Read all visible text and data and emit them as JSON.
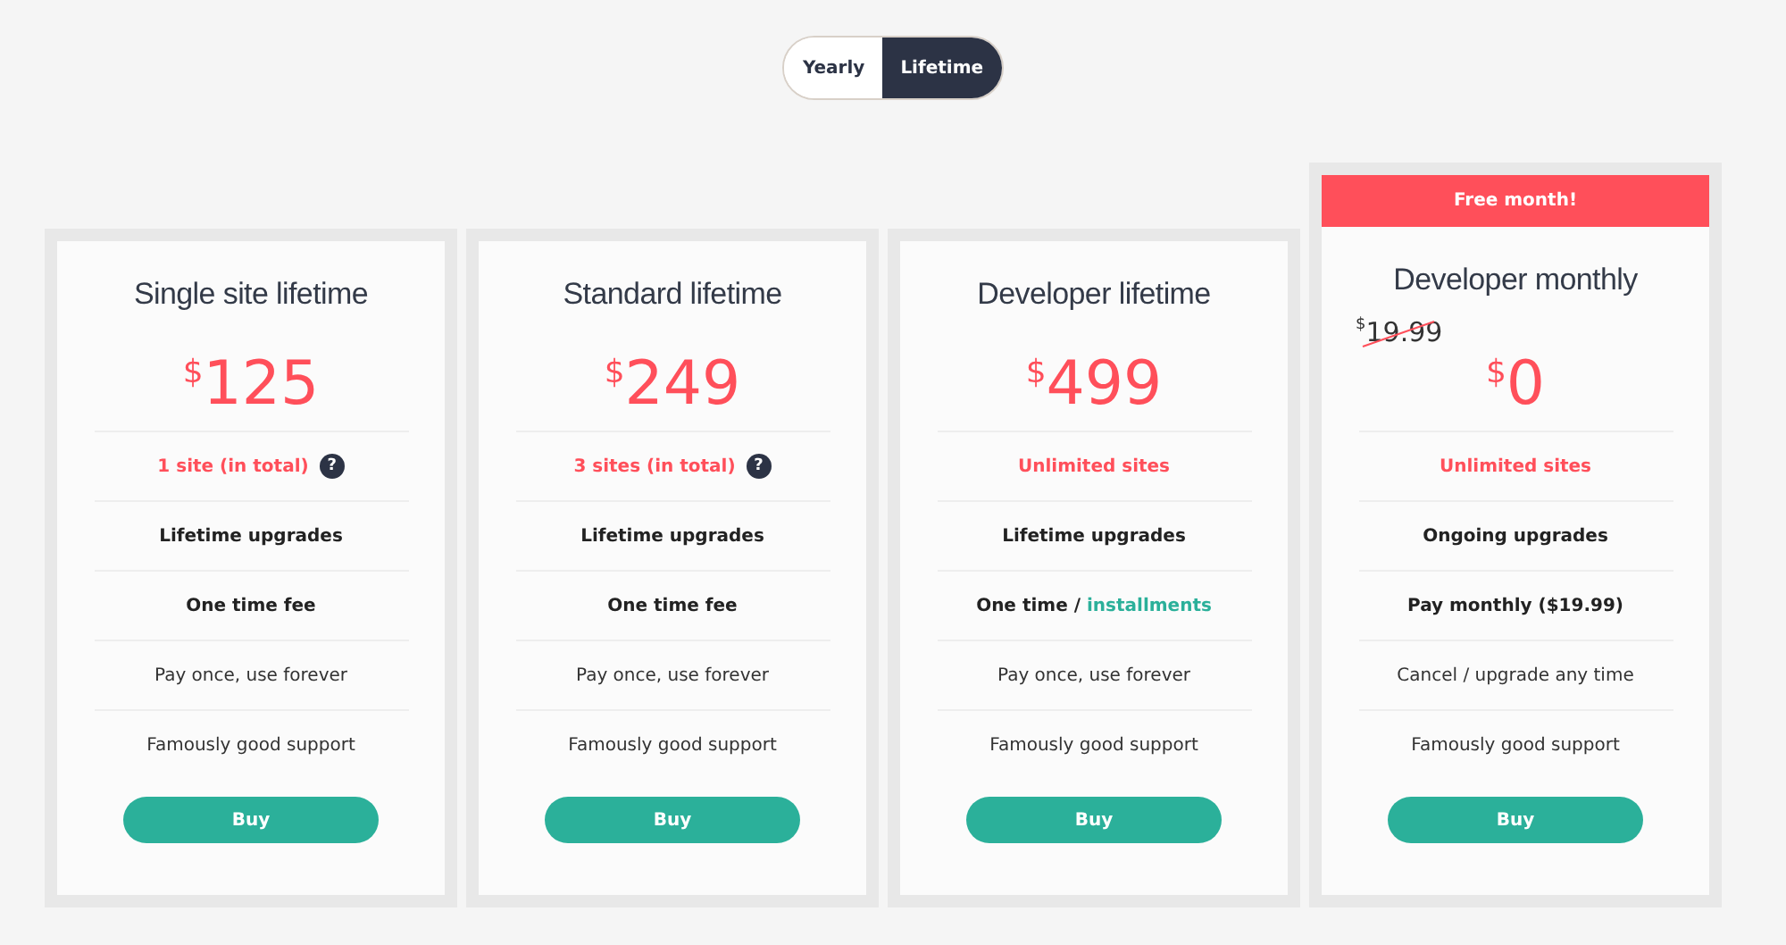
{
  "toggle": [
    {
      "label": "Yearly",
      "selected": false
    },
    {
      "label": "Lifetime",
      "selected": true
    }
  ],
  "plans": [
    {
      "title": "Single site lifetime",
      "currency": "$",
      "amount": "125",
      "features": [
        {
          "kind": "highlight",
          "text": "1 site (in total)",
          "help": "?"
        },
        {
          "kind": "bold",
          "text": "Lifetime upgrades"
        },
        {
          "kind": "bold",
          "text": "One time fee"
        },
        {
          "kind": "plain",
          "text": "Pay once, use forever"
        },
        {
          "kind": "plain",
          "text": "Famously good support"
        }
      ],
      "button": "Buy"
    },
    {
      "title": "Standard lifetime",
      "currency": "$",
      "amount": "249",
      "features": [
        {
          "kind": "highlight",
          "text": "3 sites (in total)",
          "help": "?"
        },
        {
          "kind": "bold",
          "text": "Lifetime upgrades"
        },
        {
          "kind": "bold",
          "text": "One time fee"
        },
        {
          "kind": "plain",
          "text": "Pay once, use forever"
        },
        {
          "kind": "plain",
          "text": "Famously good support"
        }
      ],
      "button": "Buy"
    },
    {
      "title": "Developer lifetime",
      "currency": "$",
      "amount": "499",
      "features": [
        {
          "kind": "highlight",
          "text": "Unlimited sites"
        },
        {
          "kind": "bold",
          "text": "Lifetime upgrades"
        },
        {
          "kind": "bold",
          "text": "One time /",
          "link": "installments"
        },
        {
          "kind": "plain",
          "text": "Pay once, use forever"
        },
        {
          "kind": "plain",
          "text": "Famously good support"
        }
      ],
      "button": "Buy"
    },
    {
      "banner": "Free month!",
      "title": "Developer monthly",
      "old_currency": "$",
      "old_amount": "19.99",
      "currency": "$",
      "amount": "0",
      "features": [
        {
          "kind": "highlight",
          "text": "Unlimited sites"
        },
        {
          "kind": "bold",
          "text": "Ongoing upgrades"
        },
        {
          "kind": "bold",
          "text": "Pay monthly ($19.99)"
        },
        {
          "kind": "plain",
          "text": "Cancel / upgrade any time"
        },
        {
          "kind": "plain",
          "text": "Famously good support"
        }
      ],
      "button": "Buy"
    }
  ]
}
